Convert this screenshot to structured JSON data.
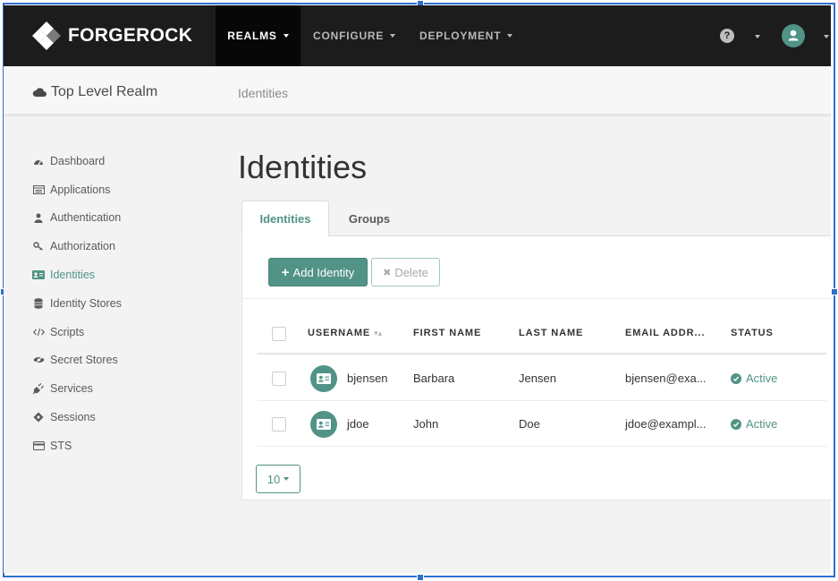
{
  "brand": {
    "name": "FORGEROCK"
  },
  "navbar": {
    "items": [
      {
        "label": "REALMS",
        "active": true
      },
      {
        "label": "CONFIGURE",
        "active": false
      },
      {
        "label": "DEPLOYMENT",
        "active": false
      }
    ],
    "help_icon": "question-circle-icon",
    "user_icon": "user-avatar-icon"
  },
  "subheader": {
    "realm": "Top Level Realm",
    "realm_icon": "cloud-icon",
    "breadcrumb": "Identities"
  },
  "sidebar": {
    "items": [
      {
        "label": "Dashboard",
        "icon": "dashboard-icon",
        "active": false
      },
      {
        "label": "Applications",
        "icon": "applications-icon",
        "active": false
      },
      {
        "label": "Authentication",
        "icon": "user-icon",
        "active": false
      },
      {
        "label": "Authorization",
        "icon": "key-icon",
        "active": false
      },
      {
        "label": "Identities",
        "icon": "id-card-icon",
        "active": true
      },
      {
        "label": "Identity Stores",
        "icon": "database-icon",
        "active": false
      },
      {
        "label": "Scripts",
        "icon": "code-icon",
        "active": false
      },
      {
        "label": "Secret Stores",
        "icon": "eye-slash-icon",
        "active": false
      },
      {
        "label": "Services",
        "icon": "plug-icon",
        "active": false
      },
      {
        "label": "Sessions",
        "icon": "ticket-icon",
        "active": false
      },
      {
        "label": "STS",
        "icon": "card-icon",
        "active": false
      }
    ]
  },
  "main": {
    "title": "Identities",
    "tabs": [
      {
        "label": "Identities",
        "active": true
      },
      {
        "label": "Groups",
        "active": false
      }
    ],
    "toolbar": {
      "add_label": "Add Identity",
      "delete_label": "Delete"
    },
    "table": {
      "columns": [
        "USERNAME",
        "FIRST NAME",
        "LAST NAME",
        "EMAIL ADDR...",
        "STATUS"
      ],
      "rows": [
        {
          "username": "bjensen",
          "first_name": "Barbara",
          "last_name": "Jensen",
          "email": "bjensen@exa...",
          "status": "Active"
        },
        {
          "username": "jdoe",
          "first_name": "John",
          "last_name": "Doe",
          "email": "jdoe@exampl...",
          "status": "Active"
        }
      ]
    },
    "page_size": "10"
  },
  "colors": {
    "accent": "#519387",
    "navbar": "#1c1c1c",
    "navbar_active": "#070707",
    "selection": "#2f6fcf"
  }
}
